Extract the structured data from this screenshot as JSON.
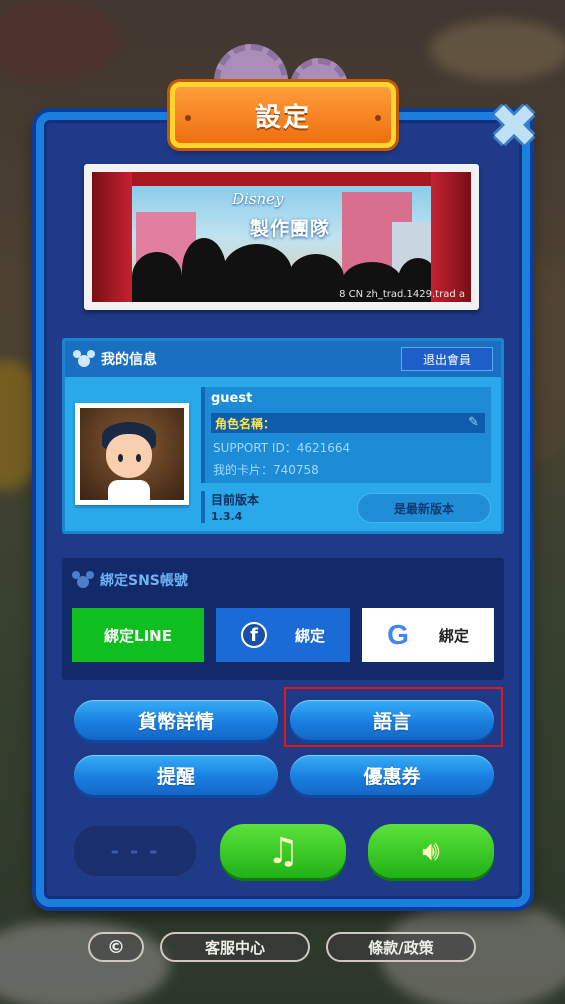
{
  "title": "設定",
  "close_icon": "close-x-icon",
  "banner": {
    "brand": "Disney",
    "title": "製作團隊",
    "version_text": "8 CN zh_trad.1429.trad a"
  },
  "my_info": {
    "header": "我的信息",
    "logout_label": "退出會員",
    "username": "guest",
    "role_name_label": "角色名稱：",
    "support_id": "SUPPORT ID：4621664",
    "my_card": "我的卡片：740758",
    "version_label": "目前版本",
    "version_number": "1.3.4",
    "latest_label": "是最新版本"
  },
  "sns": {
    "header": "綁定SNS帳號",
    "line_label": "綁定LINE",
    "facebook_label": "綁定",
    "google_label": "綁定"
  },
  "menu": {
    "currency_details": "貨幣詳情",
    "language": "語言",
    "reminder": "提醒",
    "coupon": "優惠券"
  },
  "controls": {
    "dark_button_text": "- - -",
    "music_icon": "music-note-icon",
    "sound_icon": "speaker-icon"
  },
  "footer": {
    "copyright": "©",
    "customer_service": "客服中心",
    "terms_policy": "條款/政策"
  },
  "colors": {
    "panel": "#1f3a88",
    "title_plate": "#ee6f10",
    "line_green": "#0ebf1f",
    "facebook_blue": "#1b6bd6",
    "button_blue": "#1a7fe0",
    "highlight": "#e01818"
  }
}
